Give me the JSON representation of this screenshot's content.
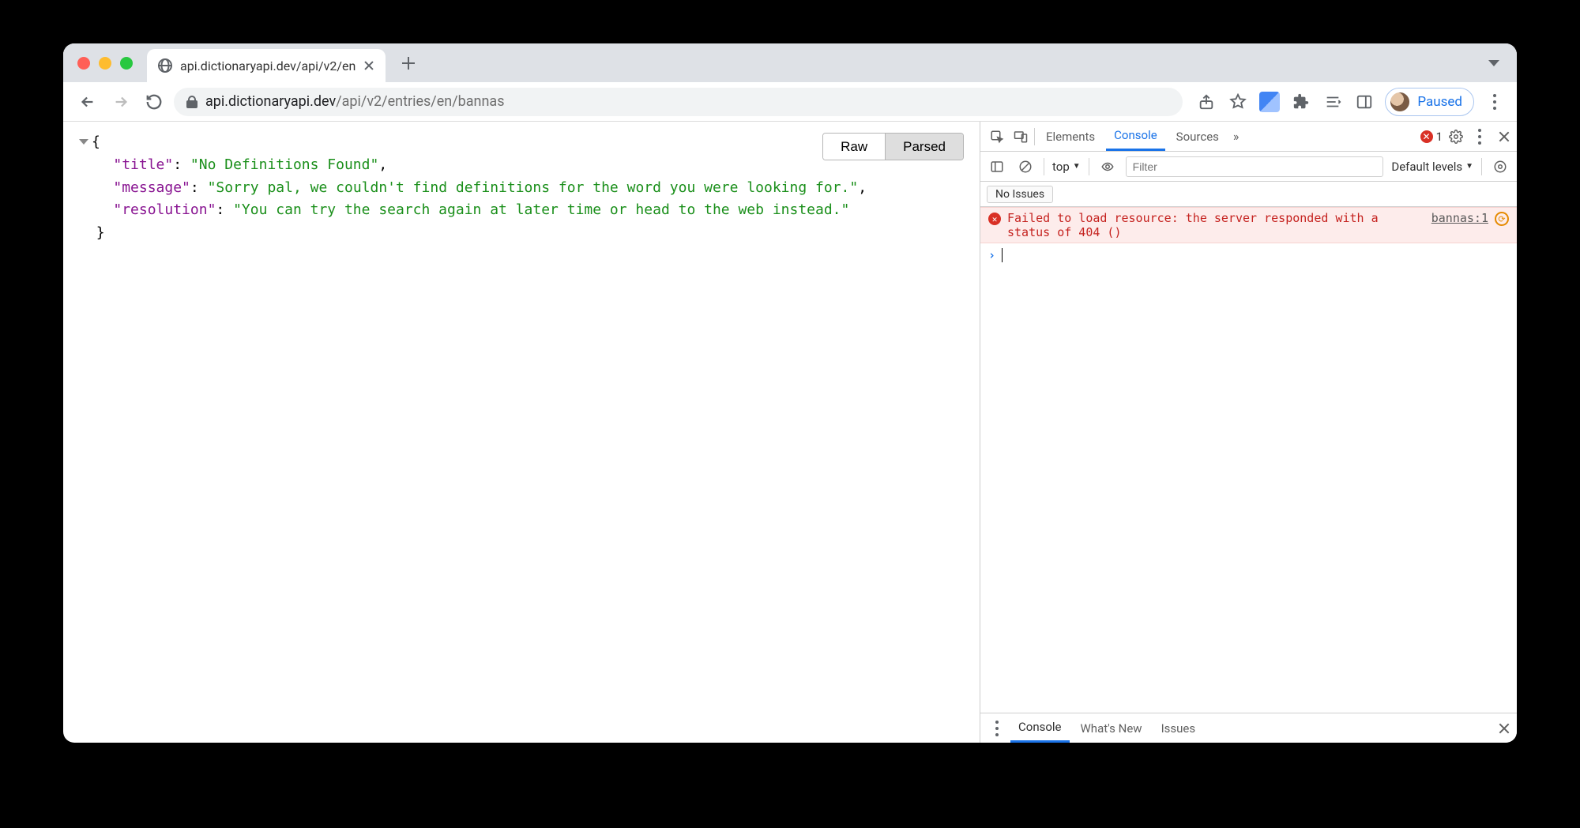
{
  "tab": {
    "title": "api.dictionaryapi.dev/api/v2/en"
  },
  "url": {
    "host": "api.dictionaryapi.dev",
    "path": "/api/v2/entries/en/bannas"
  },
  "profile": {
    "status": "Paused"
  },
  "json_toggle": {
    "raw": "Raw",
    "parsed": "Parsed"
  },
  "json": {
    "open": "{",
    "k_title": "\"title\"",
    "v_title": "\"No Definitions Found\"",
    "k_message": "\"message\"",
    "v_message": "\"Sorry pal, we couldn't find definitions for the word you were looking for.\"",
    "k_resolution": "\"resolution\"",
    "v_resolution": "\"You can try the search again at later time or head to the web instead.\"",
    "close": "}"
  },
  "devtools": {
    "tabs": {
      "elements": "Elements",
      "console": "Console",
      "sources": "Sources"
    },
    "error_count": "1",
    "context": "top",
    "filter_placeholder": "Filter",
    "levels": "Default levels",
    "no_issues": "No Issues",
    "error_msg": "Failed to load resource: the server responded with a status of 404 ()",
    "error_src": "bannas:1",
    "drawer": {
      "console": "Console",
      "whatsnew": "What's New",
      "issues": "Issues"
    }
  }
}
